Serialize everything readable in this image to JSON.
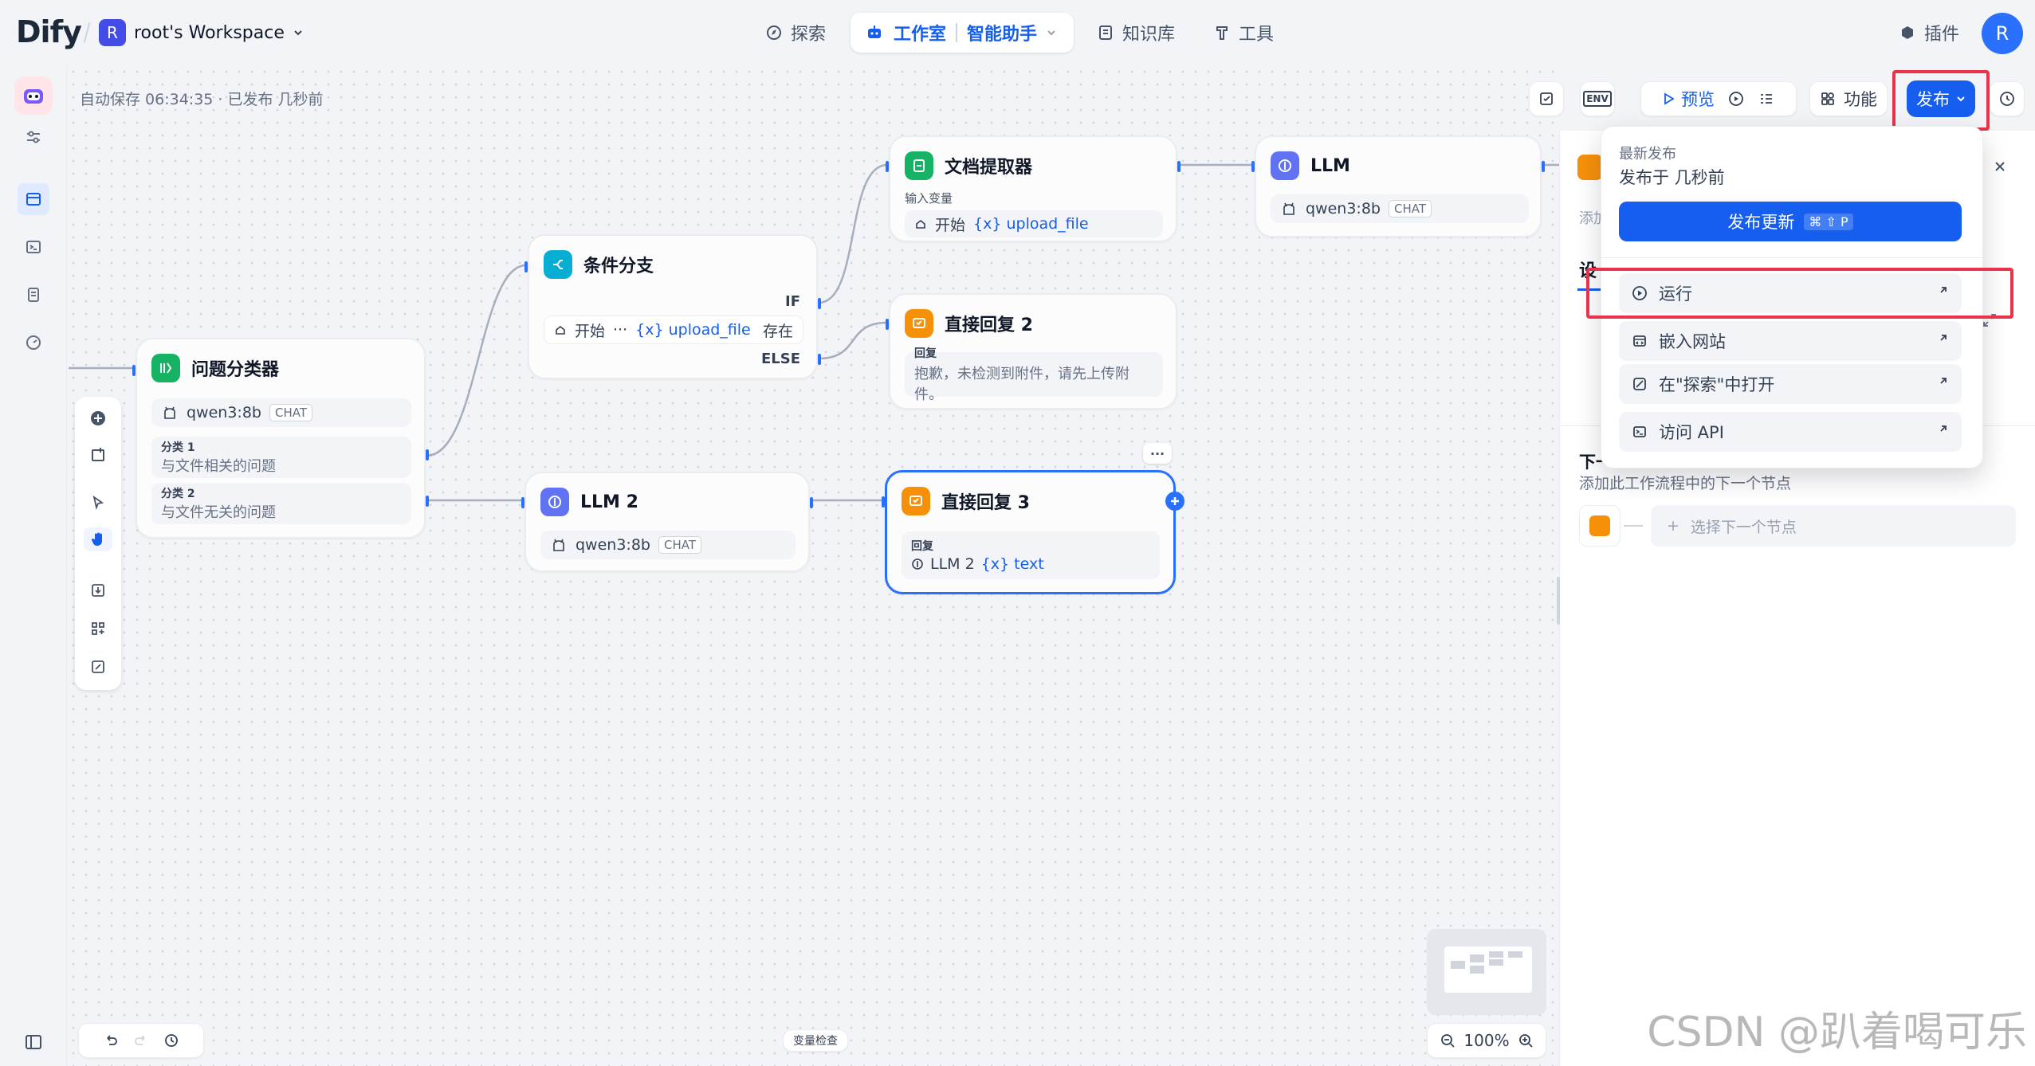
{
  "app": {
    "logo": "Dify",
    "workspace_initial": "R",
    "workspace_name": "root's Workspace",
    "user_initial": "R"
  },
  "nav": {
    "explore": "探索",
    "studio": "工作室",
    "assistant": "智能助手",
    "knowledge": "知识库",
    "tools": "工具",
    "plugins": "插件"
  },
  "status": {
    "autosave": "自动保存 06:34:35 · 已发布 几秒前"
  },
  "toolbar": {
    "env": "ENV",
    "preview": "预览",
    "features": "功能",
    "publish": "发布"
  },
  "nodes": {
    "classifier": {
      "title": "问题分类器",
      "model": "qwen3:8b",
      "mode": "CHAT",
      "classes": [
        {
          "label": "分类 1",
          "text": "与文件相关的问题"
        },
        {
          "label": "分类 2",
          "text": "与文件无关的问题"
        }
      ]
    },
    "condition": {
      "title": "条件分支",
      "if": "IF",
      "else": "ELSE",
      "start": "开始",
      "ellipsis": "···",
      "var": "{x} upload_file",
      "op": "存在"
    },
    "doc_extractor": {
      "title": "文档提取器",
      "input_label": "输入变量",
      "start": "开始",
      "var": "{x} upload_file"
    },
    "llm": {
      "title": "LLM",
      "model": "qwen3:8b",
      "mode": "CHAT"
    },
    "answer2": {
      "title": "直接回复 2",
      "label": "回复",
      "text": "抱歉，未检测到附件，请先上传附件。"
    },
    "llm2": {
      "title": "LLM 2",
      "model": "qwen3:8b",
      "mode": "CHAT"
    },
    "answer3": {
      "title": "直接回复 3",
      "label": "回复",
      "src": "LLM 2",
      "var": "{x} text",
      "more": "···"
    }
  },
  "panel": {
    "add_desc": "添加",
    "settings_prefix": "设",
    "next_title": "下一",
    "next_desc": "添加此工作流程中的下一个节点",
    "select_next": "选择下一个节点"
  },
  "dropdown": {
    "latest": "最新发布",
    "published_at": "发布于 几秒前",
    "publish_update": "发布更新",
    "shortcut": "⌘ ⇧ P",
    "items": [
      {
        "label": "运行"
      },
      {
        "label": "嵌入网站"
      },
      {
        "label": "在\"探索\"中打开"
      },
      {
        "label": "访问 API"
      }
    ]
  },
  "bottom": {
    "var_inspect": "变量检查",
    "zoom": "100%"
  },
  "watermark": "CSDN @趴着喝可乐",
  "colors": {
    "accent": "#155eef",
    "highlight": "#e8334a",
    "classifier": "#16b364",
    "condition": "#06aed4",
    "doc": "#16b364",
    "llm": "#6172f3",
    "answer": "#f79009"
  }
}
